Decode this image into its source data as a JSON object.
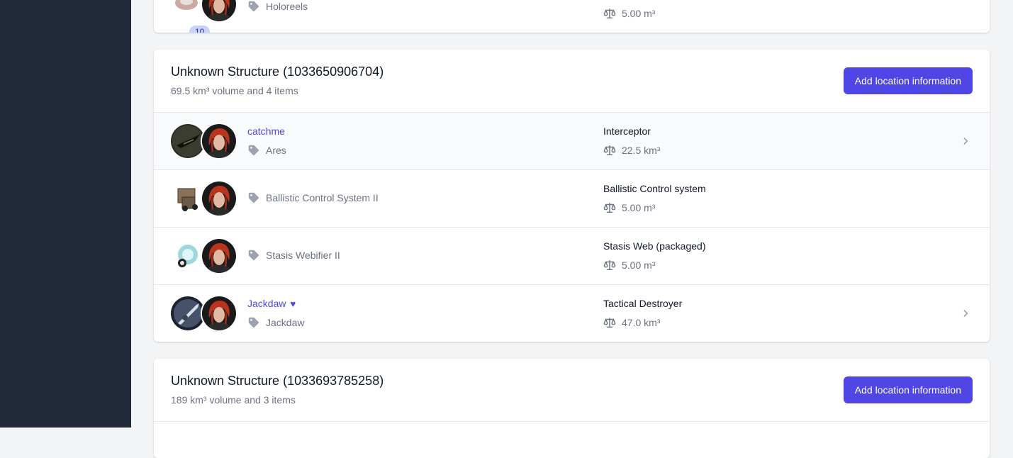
{
  "prev_card": {
    "badge": "10",
    "item_type": "Holoreels",
    "volume": "5.00 m³"
  },
  "locations": [
    {
      "title": "Unknown Structure (1033650906704)",
      "subtitle": "69.5 km³ volume and 4 items",
      "button_label": "Add location information",
      "items": [
        {
          "name": "catchme",
          "type": "Ares",
          "group": "Interceptor",
          "volume": "22.5 km³"
        },
        {
          "type": "Ballistic Control System II",
          "group": "Ballistic Control system",
          "volume": "5.00 m³"
        },
        {
          "type": "Stasis Webifier II",
          "group": "Stasis Web (packaged)",
          "volume": "5.00 m³"
        },
        {
          "name": "Jackdaw",
          "type": "Jackdaw",
          "group": "Tactical Destroyer",
          "volume": "47.0 km³"
        }
      ]
    },
    {
      "title": "Unknown Structure (1033693785258)",
      "subtitle": "189 km³ volume and 3 items",
      "button_label": "Add location information"
    }
  ],
  "icons": {
    "tag": "tag-icon",
    "volume": "scale-icon",
    "favorite": "heart-icon",
    "chevron": "chevron-right-icon"
  },
  "colors": {
    "sidebar": "#1f2937",
    "accent": "#4f46e5",
    "background": "#f3f4f6"
  }
}
